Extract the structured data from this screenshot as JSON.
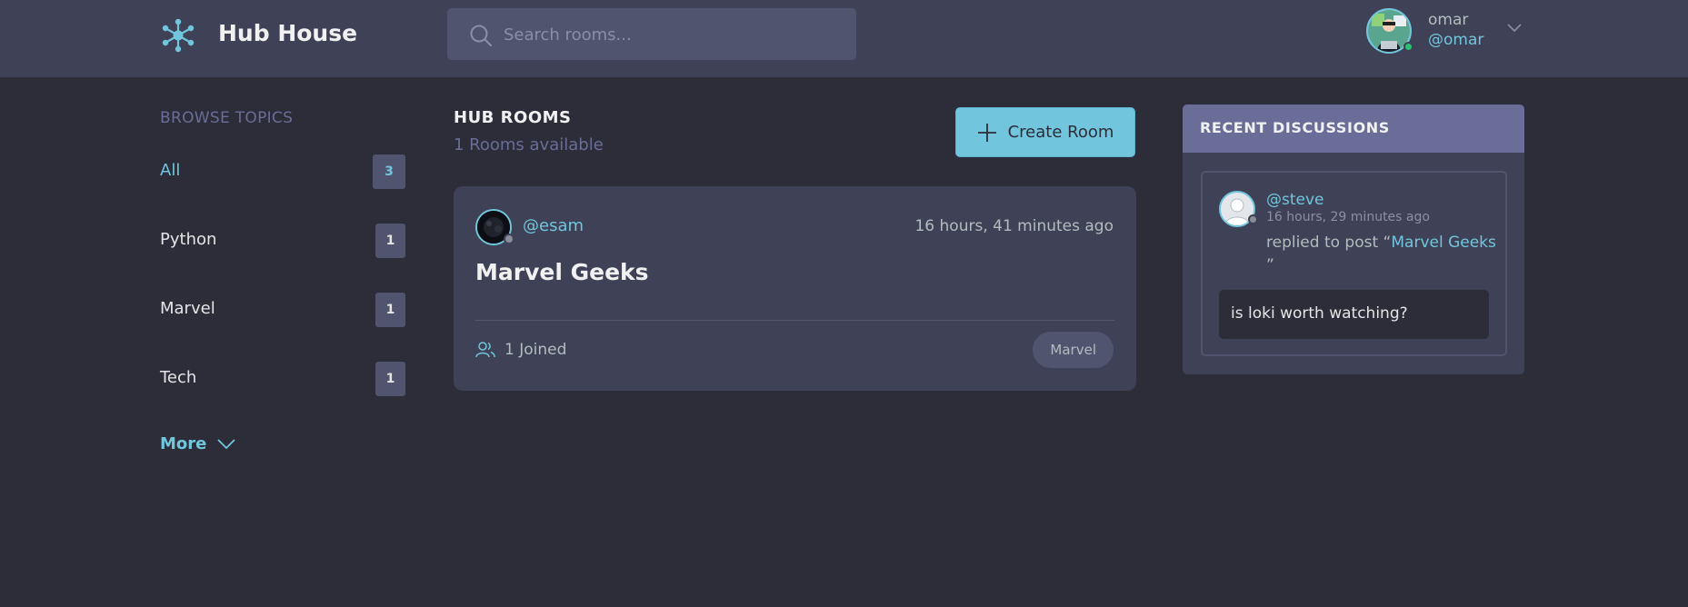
{
  "header": {
    "brand": "Hub House",
    "search_placeholder": "Search rooms...",
    "user": {
      "name": "omar",
      "handle": "@omar"
    }
  },
  "sidebar": {
    "title": "BROWSE TOPICS",
    "topics": [
      {
        "label": "All",
        "count": "3"
      },
      {
        "label": "Python",
        "count": "1"
      },
      {
        "label": "Marvel",
        "count": "1"
      },
      {
        "label": "Tech",
        "count": "1"
      }
    ],
    "more_label": "More"
  },
  "main": {
    "title": "HUB ROOMS",
    "subtitle": "1 Rooms available",
    "create_label": "Create Room",
    "rooms": [
      {
        "host": "@esam",
        "time": "16 hours, 41 minutes ago",
        "name": "Marvel Geeks",
        "joined": "1 Joined",
        "topic": "Marvel"
      }
    ]
  },
  "activity": {
    "title": "RECENT DISCUSSIONS",
    "items": [
      {
        "user": "@steve",
        "time": "16 hours, 29 minutes ago",
        "action_prefix": "replied to post “",
        "room": "Marvel Geeks",
        "action_suffix": "”",
        "body": "is loki worth watching?"
      }
    ]
  },
  "colors": {
    "background": "#2d2d39",
    "surface": "#3f4156",
    "accent": "#71c6dd",
    "muted": "#696d97",
    "online": "#2bc36f"
  }
}
